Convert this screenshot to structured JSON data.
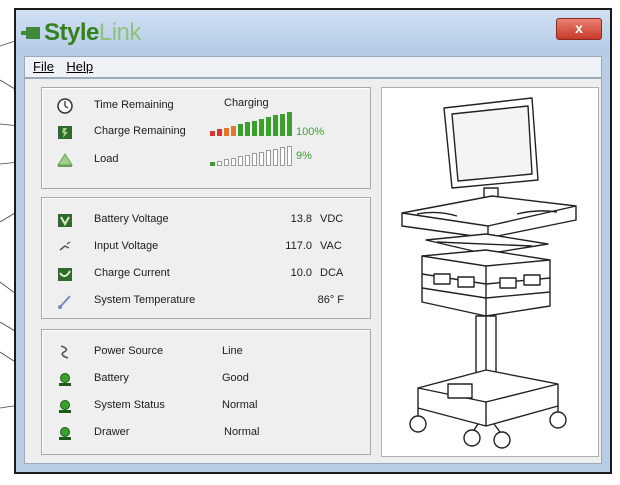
{
  "title": {
    "brand_style": "Style",
    "brand_link": "Link"
  },
  "window": {
    "close_label": "x"
  },
  "menu": [
    {
      "label": "File"
    },
    {
      "label": "Help"
    }
  ],
  "status_panel": {
    "time_remaining": {
      "label": "Time Remaining",
      "value": "Charging",
      "icon": "clock-icon"
    },
    "charge_remaining": {
      "label": "Charge Remaining",
      "percent_text": "100%",
      "icon": "battery-charge-icon",
      "level": 1.0
    },
    "load": {
      "label": "Load",
      "percent_text": "9%",
      "icon": "load-icon",
      "level": 0.09
    }
  },
  "measurements_panel": [
    {
      "label": "Battery Voltage",
      "value": "13.8",
      "unit": "VDC",
      "icon": "battery-voltage-icon"
    },
    {
      "label": "Input Voltage",
      "value": "117.0",
      "unit": "VAC",
      "icon": "plug-icon"
    },
    {
      "label": "Charge Current",
      "value": "10.0",
      "unit": "DCA",
      "icon": "charge-current-icon"
    },
    {
      "label": "System Temperature",
      "value": "86° F",
      "unit": "",
      "icon": "thermometer-icon"
    }
  ],
  "system_panel": [
    {
      "label": "Power Source",
      "value": "Line",
      "icon": "power-cord-icon"
    },
    {
      "label": "Battery",
      "value": "Good",
      "icon": "battery-status-icon"
    },
    {
      "label": "System Status",
      "value": "Normal",
      "icon": "system-status-icon"
    },
    {
      "label": "Drawer",
      "value": "Normal",
      "icon": "drawer-status-icon"
    }
  ],
  "colors": {
    "brand_green": "#35801f",
    "level_green": "#3aa02c",
    "level_red": "#d23a2e",
    "level_orange": "#e07a2a",
    "window_blue": "#b9cde4"
  }
}
